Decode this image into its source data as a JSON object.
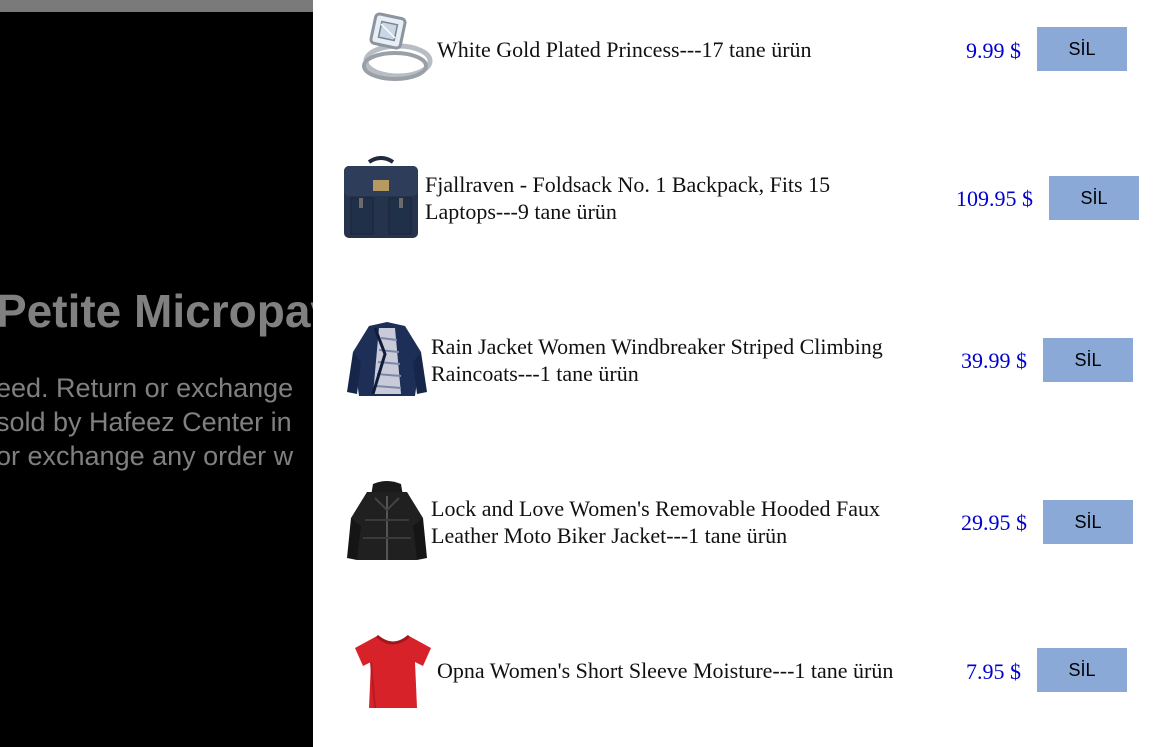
{
  "background": {
    "title": "Petite Micropav",
    "description_lines": [
      "eed. Return or exchange",
      "sold by Hafeez Center in",
      "or exchange any order w"
    ]
  },
  "cart": {
    "items": [
      {
        "name": "White Gold Plated Princess---17 tane ürün",
        "price": "9.99 $",
        "delete_label": "SİL",
        "icon": "ring-icon"
      },
      {
        "name": "Fjallraven - Foldsack No. 1 Backpack, Fits 15 Laptops---9 tane ürün",
        "price": "109.95 $",
        "delete_label": "SİL",
        "icon": "backpack-icon"
      },
      {
        "name": "Rain Jacket Women Windbreaker Striped Climbing Raincoats---1 tane ürün",
        "price": "39.99 $",
        "delete_label": "SİL",
        "icon": "rain-jacket-icon"
      },
      {
        "name": "Lock and Love Women's Removable Hooded Faux Leather Moto Biker Jacket---1 tane ürün",
        "price": "29.95 $",
        "delete_label": "SİL",
        "icon": "leather-jacket-icon"
      },
      {
        "name": "Opna Women's Short Sleeve Moisture---1 tane ürün",
        "price": "7.95 $",
        "delete_label": "SİL",
        "icon": "red-tshirt-icon"
      }
    ]
  },
  "colors": {
    "price": "#0000d0",
    "button": "#8aa9d6",
    "overlay": "#000000"
  }
}
